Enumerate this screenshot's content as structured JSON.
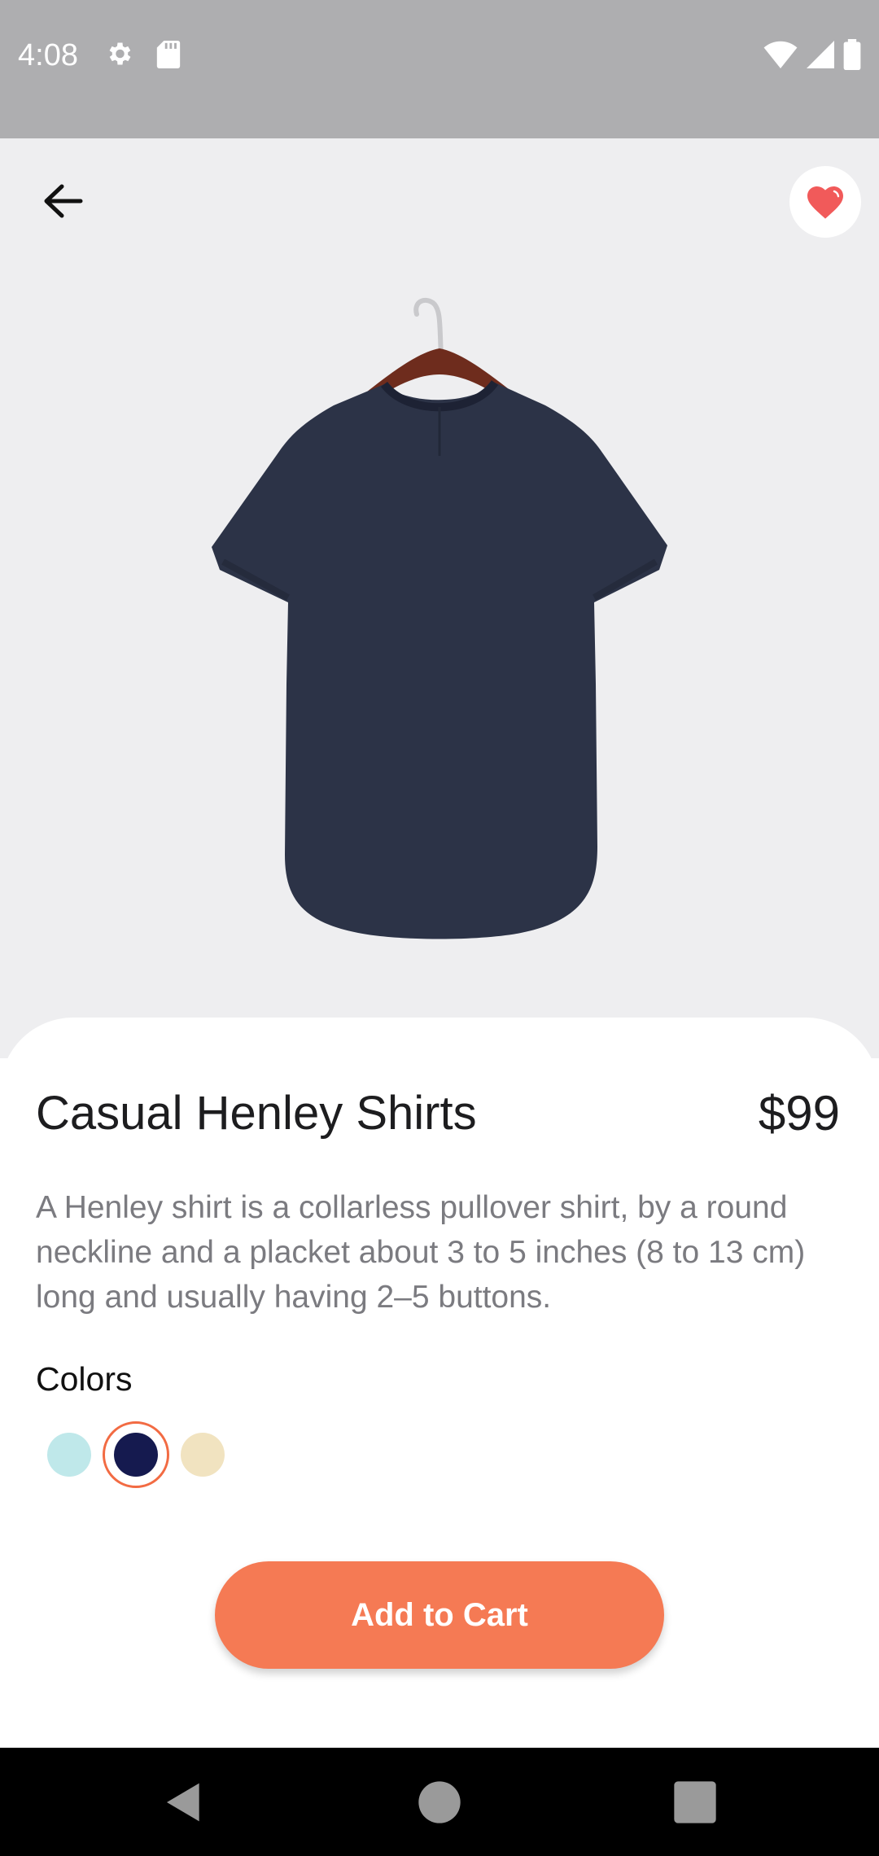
{
  "status_bar": {
    "time": "4:08",
    "icons": [
      "gear-icon",
      "sd-card-icon",
      "wifi-icon",
      "cell-signal-icon",
      "battery-icon"
    ]
  },
  "header": {
    "back_icon": "arrow-left-icon",
    "favorite_icon": "heart-icon",
    "favorite_color": "#f15a5a"
  },
  "product": {
    "image": "navy-t-shirt-on-hanger",
    "title": "Casual Henley Shirts",
    "price": "$99",
    "description": "A Henley shirt is a collarless pullover shirt, by a round neckline and a placket about 3 to 5 inches (8 to 13 cm) long and usually having 2–5 buttons.",
    "colors_label": "Colors",
    "colors": [
      {
        "name": "light-cyan",
        "hex": "#bfe8ea",
        "selected": false
      },
      {
        "name": "navy",
        "hex": "#151a4f",
        "selected": true
      },
      {
        "name": "cream",
        "hex": "#f1e3c0",
        "selected": false
      }
    ],
    "selected_ring_color": "#f26b43"
  },
  "actions": {
    "add_to_cart_label": "Add to Cart",
    "accent_color": "#f57a54"
  },
  "nav_bar": {
    "icons": [
      "back-triangle-icon",
      "home-circle-icon",
      "recents-square-icon"
    ]
  }
}
